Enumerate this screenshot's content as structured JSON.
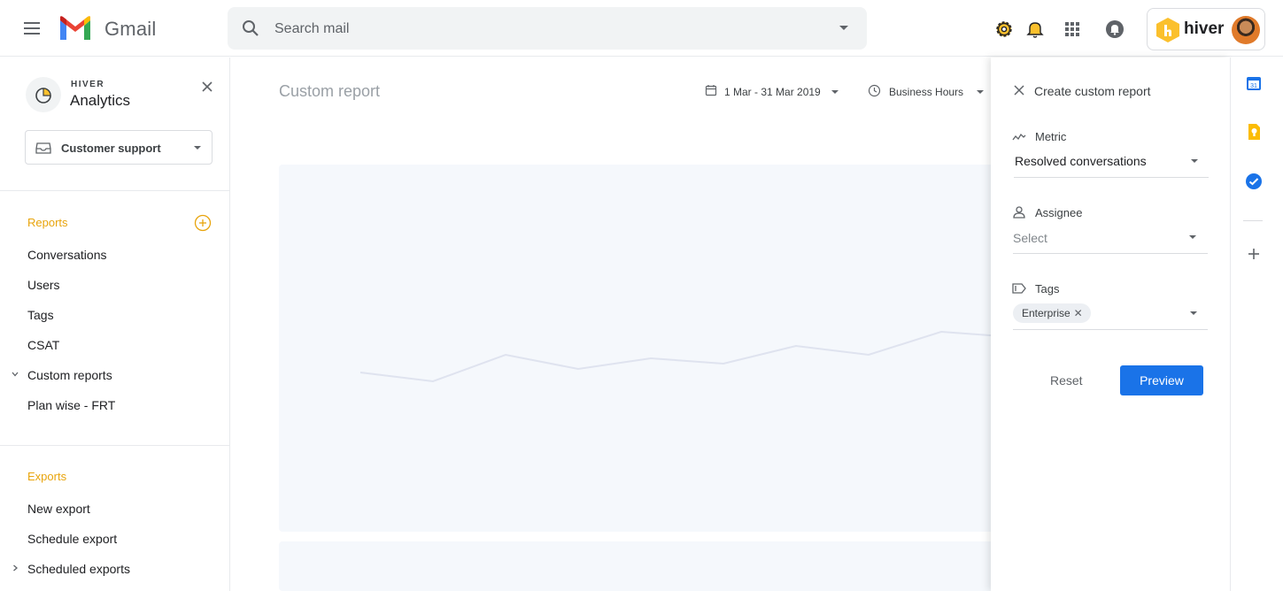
{
  "topbar": {
    "app_name": "Gmail",
    "search_placeholder": "Search mail",
    "hiver_brand": "hiver"
  },
  "sidebar": {
    "brand": "HIVER",
    "title": "Analytics",
    "inbox_selector": "Customer support",
    "reports_title": "Reports",
    "reports_items": [
      "Conversations",
      "Users",
      "Tags",
      "CSAT",
      "Custom reports",
      "Plan wise - FRT"
    ],
    "exports_title": "Exports",
    "exports_items": [
      "New export",
      "Schedule export",
      "Scheduled exports"
    ]
  },
  "main": {
    "report_title": "Custom report",
    "date_range": "1 Mar - 31 Mar 2019",
    "hours_filter": "Business Hours"
  },
  "panel": {
    "title": "Create custom report",
    "metric_label": "Metric",
    "metric_value": "Resolved conversations",
    "assignee_label": "Assignee",
    "assignee_placeholder": "Select",
    "tags_label": "Tags",
    "tag_chip": "Enterprise",
    "reset_label": "Reset",
    "preview_label": "Preview"
  },
  "chart_data": {
    "type": "line",
    "series": [
      {
        "values": [
          10,
          5,
          20,
          12,
          18,
          15,
          25,
          20,
          33,
          30
        ]
      }
    ],
    "note_visible": false
  },
  "colors": {
    "accent_orange": "#e8a40c",
    "primary_blue": "#1a73e8"
  }
}
